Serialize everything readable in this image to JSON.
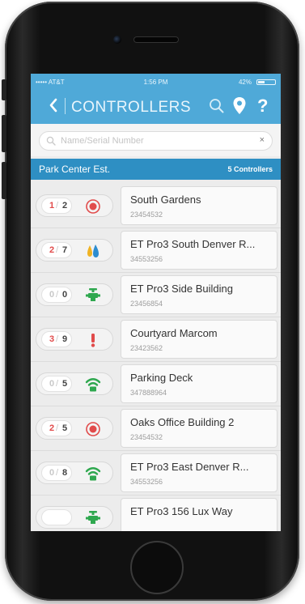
{
  "status_bar": {
    "carrier": "••••• AT&T",
    "time": "1:56 PM",
    "battery": "42%",
    "battery_level": 0.42
  },
  "nav": {
    "title": "CONTROLLERS",
    "back_icon": "chevron-left-icon",
    "help_label": "?"
  },
  "search": {
    "placeholder": "Name/Serial Number",
    "value": "",
    "clear_label": "×"
  },
  "group": {
    "name": "Park Center Est.",
    "count_label": "5 Controllers"
  },
  "colors": {
    "header": "#4fa9d8",
    "group_bar": "#2e8fc3",
    "alert_red": "#e14b4b",
    "ok_green": "#2fa84f",
    "water_blue": "#2d8dd0",
    "water_yellow": "#f0b323",
    "counter_zero": "#c8c8c8"
  },
  "controllers": [
    {
      "a": "1",
      "b": "2",
      "a_color": "#e14b4b",
      "icon": "target-icon",
      "name": "South Gardens",
      "serial": "23454532"
    },
    {
      "a": "2",
      "b": "7",
      "a_color": "#e14b4b",
      "icon": "water-drops-icon",
      "name": "ET Pro3 South Denver R...",
      "serial": "34553256"
    },
    {
      "a": "0",
      "b": "0",
      "a_color": "#c8c8c8",
      "icon": "valve-icon",
      "name": "ET Pro3 Side Building",
      "serial": "23456854"
    },
    {
      "a": "3",
      "b": "9",
      "a_color": "#e14b4b",
      "icon": "exclamation-icon",
      "name": "Courtyard Marcom",
      "serial": "23423562"
    },
    {
      "a": "0",
      "b": "5",
      "a_color": "#c8c8c8",
      "icon": "wifi-icon",
      "name": "Parking Deck",
      "serial": "347888964"
    },
    {
      "a": "2",
      "b": "5",
      "a_color": "#e14b4b",
      "icon": "target-icon",
      "name": "Oaks Office Building 2",
      "serial": "23454532"
    },
    {
      "a": "0",
      "b": "8",
      "a_color": "#c8c8c8",
      "icon": "wifi-icon",
      "name": "ET Pro3 East Denver R...",
      "serial": "34553256"
    },
    {
      "a": "",
      "b": "",
      "a_color": "#c8c8c8",
      "icon": "valve-icon",
      "name": "ET Pro3 156 Lux Way",
      "serial": ""
    }
  ]
}
